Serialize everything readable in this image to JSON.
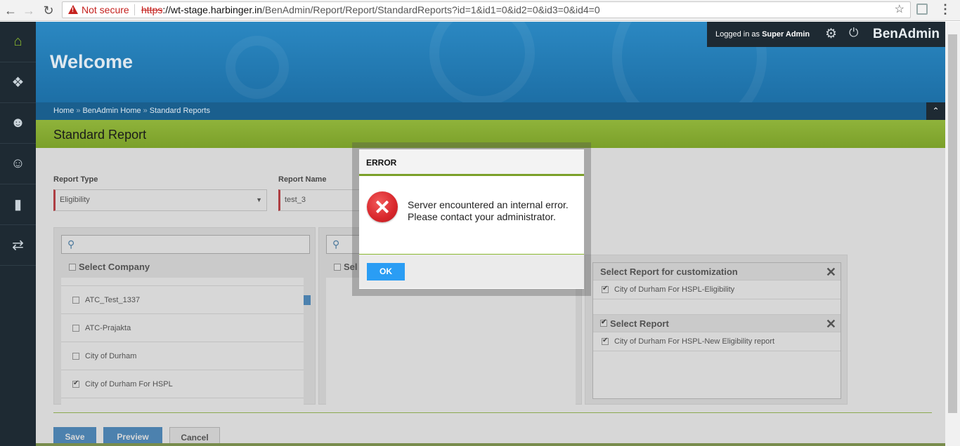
{
  "browser": {
    "not_secure": "Not secure",
    "url_scheme": "https",
    "url_host": "://wt-stage.harbinger.in",
    "url_path": "/BenAdmin/Report/Report/StandardReports?id=1&id1=0&id2=0&id3=0&id4=0"
  },
  "header": {
    "welcome": "Welcome",
    "logged_in_prefix": "Logged in as ",
    "user": "Super Admin",
    "brand": "BenAdmin"
  },
  "breadcrumb": [
    "Home",
    "BenAdmin Home",
    "Standard Reports"
  ],
  "breadcrumb_sep": "»",
  "page_title": "Standard Report",
  "form": {
    "report_type_label": "Report Type",
    "report_type_value": "Eligibility",
    "report_name_label": "Report Name",
    "report_name_value": "test_3"
  },
  "company_panel": {
    "header": "Select Company",
    "items": [
      {
        "label": "ATC_Test_1337",
        "checked": false
      },
      {
        "label": "ATC-Prajakta",
        "checked": false
      },
      {
        "label": "City of Durham",
        "checked": false
      },
      {
        "label": "City of Durham For HSPL",
        "checked": true
      }
    ]
  },
  "middle_panel": {
    "header_partial": "Sel"
  },
  "right_panel": {
    "customize_header": "Select Report for customization",
    "customize_item": "City of Durham For HSPL-Eligibility",
    "select_header": "Select Report",
    "select_item": "City of Durham For HSPL-New Eligibility report"
  },
  "buttons": {
    "save": "Save",
    "preview": "Preview",
    "cancel": "Cancel"
  },
  "modal": {
    "title": "ERROR",
    "message": "Server encountered an internal error. Please contact your administrator.",
    "ok": "OK"
  },
  "colors": {
    "accent_green": "#7ba029",
    "banner_blue": "#2b88c2",
    "sidebar_dark": "#1e2a33",
    "error_red": "#d8262b",
    "button_blue": "#2a9df4"
  }
}
